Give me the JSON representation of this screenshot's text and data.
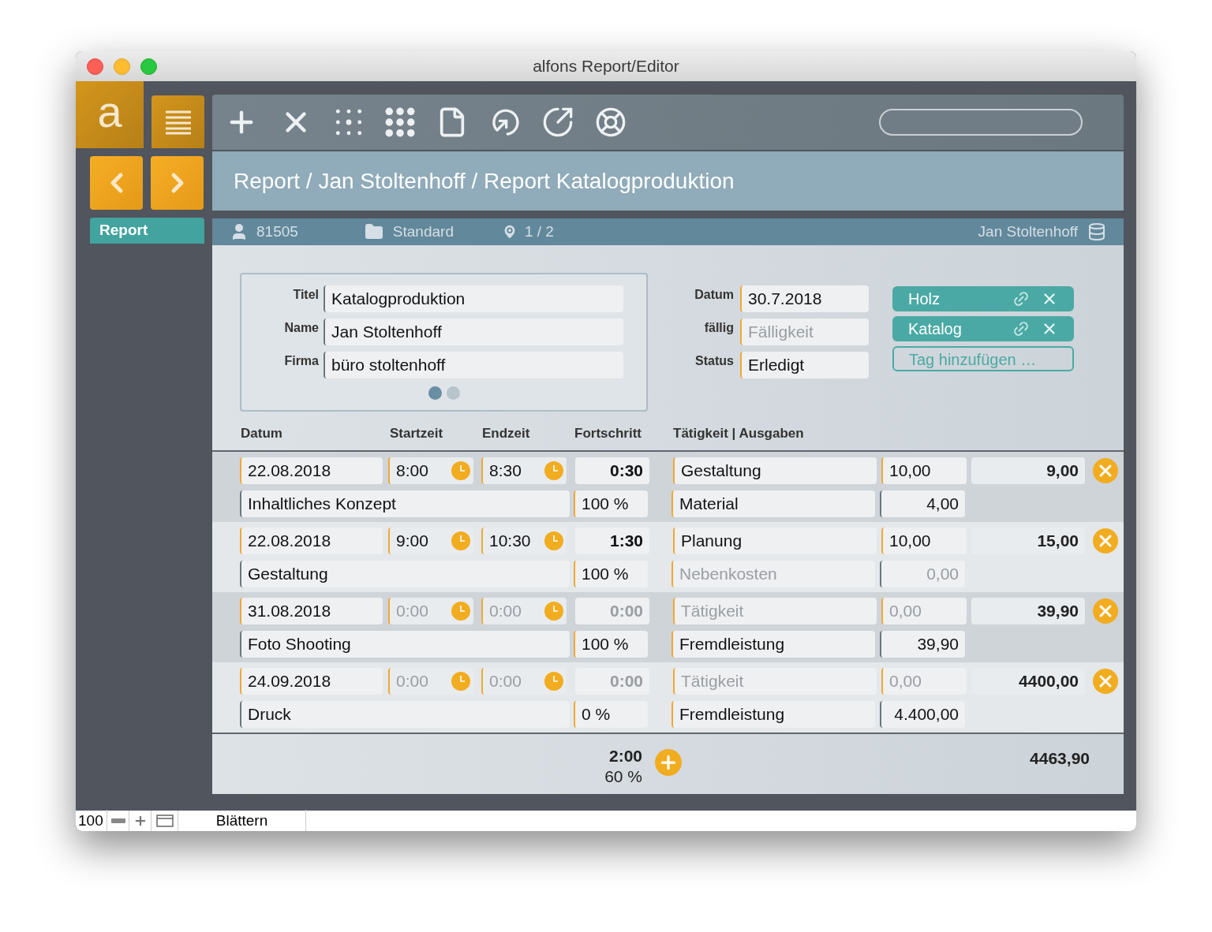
{
  "window": {
    "title": "alfons Report/Editor"
  },
  "sidebar": {
    "logo_letter": "a",
    "nav_items": [
      {
        "label": "Report",
        "selected": true
      }
    ]
  },
  "breadcrumb": "Report / Jan Stoltenhoff / Report Katalogproduktion",
  "info_bar": {
    "record_number": "81505",
    "folder": "Standard",
    "position": "1 / 2",
    "user": "Jan Stoltenhoff"
  },
  "form": {
    "fields": [
      {
        "label": "Titel",
        "value": "Katalogproduktion"
      },
      {
        "label": "Name",
        "value": "Jan Stoltenhoff"
      },
      {
        "label": "Firma",
        "value": "büro stoltenhoff"
      }
    ],
    "pages": [
      {
        "selected": true
      },
      {
        "selected": false
      }
    ],
    "side_fields": [
      {
        "label": "Datum",
        "value": "30.7.2018"
      },
      {
        "label": "fällig",
        "placeholder": "Fälligkeit"
      },
      {
        "label": "Status",
        "value": "Erledigt"
      }
    ]
  },
  "tags": [
    {
      "label": "Holz"
    },
    {
      "label": "Katalog"
    }
  ],
  "add_tag": "Tag hinzufügen …",
  "table": {
    "columns": [
      "Datum",
      "Startzeit",
      "Endzeit",
      "Fortschritt",
      "Tätigkeit | Ausgaben"
    ],
    "rows": [
      {
        "date": {
          "value": "22.08.2018"
        },
        "start": {
          "value": "8:00"
        },
        "end": {
          "value": "8:30"
        },
        "duration": {
          "value": "0:30"
        },
        "activity": {
          "value": "Gestaltung"
        },
        "rate": {
          "value": "10,00"
        },
        "amount": "9,00",
        "description": {
          "value": "Inhaltliches Konzept"
        },
        "progress": {
          "value": "100 %"
        },
        "expense_type": {
          "value": "Material"
        },
        "expense_amount": {
          "value": "4,00"
        }
      },
      {
        "date": {
          "value": "22.08.2018"
        },
        "start": {
          "value": "9:00"
        },
        "end": {
          "value": "10:30"
        },
        "duration": {
          "value": "1:30"
        },
        "activity": {
          "value": "Planung"
        },
        "rate": {
          "value": "10,00"
        },
        "amount": "15,00",
        "description": {
          "value": "Gestaltung"
        },
        "progress": {
          "value": "100 %"
        },
        "expense_type": {
          "placeholder": "Nebenkosten"
        },
        "expense_amount": {
          "placeholder": "0,00"
        }
      },
      {
        "date": {
          "value": "31.08.2018"
        },
        "start": {
          "placeholder": "0:00"
        },
        "end": {
          "placeholder": "0:00"
        },
        "duration": {
          "placeholder": "0:00"
        },
        "activity": {
          "placeholder": "Tätigkeit"
        },
        "rate": {
          "placeholder": "0,00"
        },
        "amount": "39,90",
        "description": {
          "value": "Foto Shooting"
        },
        "progress": {
          "value": "100 %"
        },
        "expense_type": {
          "value": "Fremdleistung"
        },
        "expense_amount": {
          "value": "39,90"
        }
      },
      {
        "date": {
          "value": "24.09.2018"
        },
        "start": {
          "placeholder": "0:00"
        },
        "end": {
          "placeholder": "0:00"
        },
        "duration": {
          "placeholder": "0:00"
        },
        "activity": {
          "placeholder": "Tätigkeit"
        },
        "rate": {
          "placeholder": "0,00"
        },
        "amount": "4400,00",
        "description": {
          "value": "Druck"
        },
        "progress": {
          "value": "0 %"
        },
        "expense_type": {
          "value": "Fremdleistung"
        },
        "expense_amount": {
          "value": "4.400,00"
        }
      }
    ],
    "totals": {
      "duration": "2:00",
      "progress": "60 %",
      "amount": "4463,90"
    }
  },
  "status_bar": {
    "zoom": "100",
    "mode": "Blättern"
  }
}
